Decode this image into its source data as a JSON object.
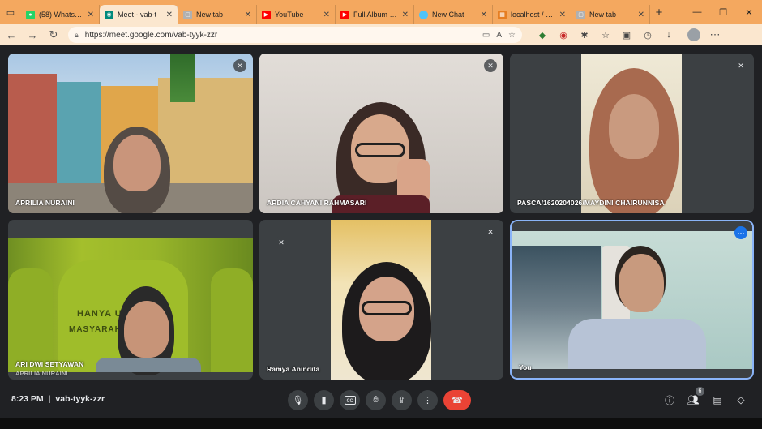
{
  "browser": {
    "tabs": [
      {
        "label": "(58) WhatsApp",
        "icon": "whatsapp-icon",
        "color": "#25d366",
        "active": false
      },
      {
        "label": "Meet - vab-t",
        "icon": "meet-icon",
        "color": "#00897b",
        "active": true
      },
      {
        "label": "New tab",
        "icon": "newtab-icon",
        "color": "#9e9e9e",
        "active": false
      },
      {
        "label": "YouTube",
        "icon": "youtube-icon",
        "color": "#ff0000",
        "active": false
      },
      {
        "label": "Full Album + Lirik",
        "icon": "youtube-icon",
        "color": "#ff0000",
        "active": false
      },
      {
        "label": "New Chat",
        "icon": "chat-icon",
        "color": "#4fc3f7",
        "active": false
      },
      {
        "label": "localhost / 127.0.0",
        "icon": "db-icon",
        "color": "#e67e22",
        "active": false
      },
      {
        "label": "New tab",
        "icon": "newtab-icon",
        "color": "#9e9e9e",
        "active": false
      }
    ],
    "url": "https://meet.google.com/vab-tyyk-zzr"
  },
  "participants": [
    {
      "name": "APRILIA NURAINI",
      "muted": true
    },
    {
      "name": "ARDIA CAHYANI RAHMASARI",
      "muted": true
    },
    {
      "name": "PASCA/1620204026/MAYDINI CHAIRUNNISA",
      "muted": true
    },
    {
      "name": "ARI DWI SETYAWAN",
      "muted": false
    },
    {
      "name": "Ramya Anindita",
      "muted": true
    },
    {
      "name": "You",
      "muted": false
    }
  ],
  "overlay_text": {
    "hanya": "HANYA U",
    "masyarakat": "MASYARAKAT",
    "ghost_name": "APRILIA NURAINI"
  },
  "meeting": {
    "time": "8:23 PM",
    "code": "vab-tyyk-zzr",
    "participant_count": "6"
  },
  "colors": {
    "accent": "#1a73e8",
    "leave": "#ea4335",
    "tabbar": "#f4a85f"
  }
}
